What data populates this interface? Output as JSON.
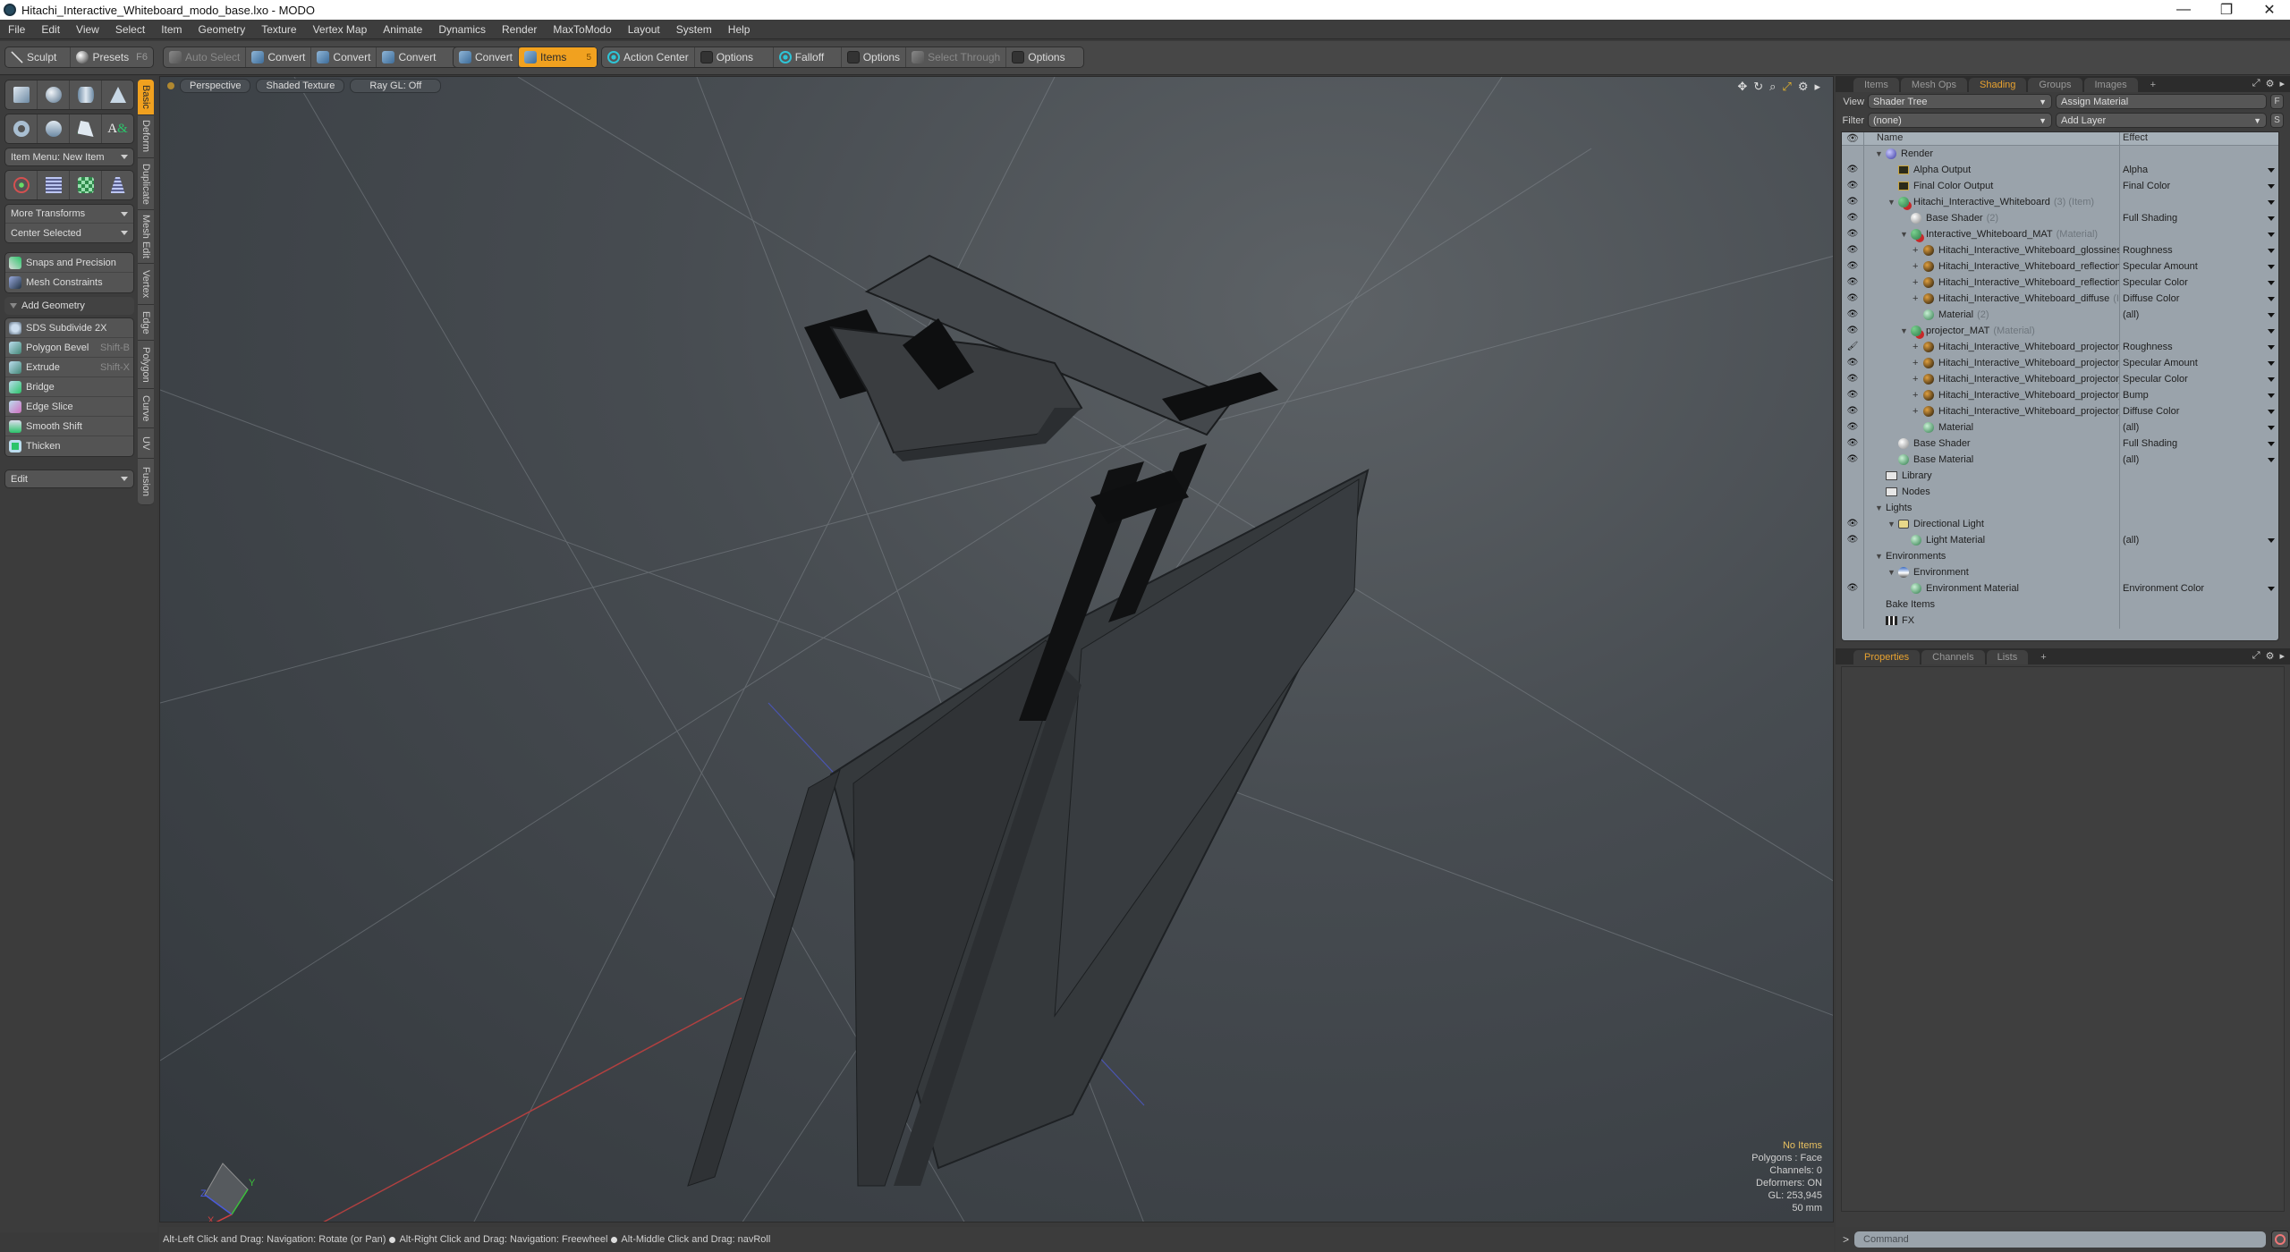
{
  "window": {
    "title": "Hitachi_Interactive_Whiteboard_modo_base.lxo - MODO",
    "controls": [
      "minimize",
      "restore",
      "close"
    ]
  },
  "menu": [
    "File",
    "Edit",
    "View",
    "Select",
    "Item",
    "Geometry",
    "Texture",
    "Vertex Map",
    "Animate",
    "Dynamics",
    "Render",
    "MaxToModo",
    "Layout",
    "System",
    "Help"
  ],
  "toolbar": {
    "sculpt": "Sculpt",
    "presets": "Presets",
    "presets_shortcut": "F6",
    "auto_select": "Auto Select",
    "convert1": "Convert",
    "convert2": "Convert",
    "convert3": "Convert",
    "convert4": "Convert",
    "items": "Items",
    "items_badge": "5",
    "action_center": "Action Center",
    "options1": "Options",
    "falloff": "Falloff",
    "options2": "Options",
    "select_through": "Select Through",
    "options3": "Options"
  },
  "left_panel": {
    "item_menu": "Item Menu: New Item",
    "more_transforms": "More Transforms",
    "center_selected": "Center Selected",
    "snaps": "Snaps and Precision",
    "mesh_constraints": "Mesh Constraints",
    "add_geometry": "Add Geometry",
    "tools": [
      {
        "label": "SDS Subdivide 2X",
        "shortcut": ""
      },
      {
        "label": "Polygon Bevel",
        "shortcut": "Shift-B"
      },
      {
        "label": "Extrude",
        "shortcut": "Shift-X"
      },
      {
        "label": "Bridge",
        "shortcut": ""
      },
      {
        "label": "Edge Slice",
        "shortcut": ""
      },
      {
        "label": "Smooth Shift",
        "shortcut": ""
      },
      {
        "label": "Thicken",
        "shortcut": ""
      }
    ],
    "edit_dropdown": "Edit",
    "vtabs": [
      "Basic",
      "Deform",
      "Duplicate",
      "Mesh Edit",
      "Vertex",
      "Edge",
      "Polygon",
      "Curve",
      "UV",
      "Fusion"
    ]
  },
  "viewport": {
    "view": "Perspective",
    "shading": "Shaded Texture",
    "raygl": "Ray GL: Off",
    "info": [
      "No Items",
      "Polygons : Face",
      "Channels: 0",
      "Deformers: ON",
      "GL: 253,945",
      "50 mm"
    ],
    "axes": {
      "x": "X",
      "y": "Y",
      "z": "Z"
    }
  },
  "right_panel": {
    "tabs": [
      "Items",
      "Mesh Ops",
      "Shading",
      "Groups",
      "Images"
    ],
    "active_tab": "Shading",
    "view_label": "View",
    "view_value": "Shader Tree",
    "assign_material": "Assign Material",
    "f_btn": "F",
    "filter_label": "Filter",
    "filter_value": "(none)",
    "add_layer": "Add Layer",
    "s_btn": "S",
    "col_name": "Name",
    "col_effect": "Effect",
    "rows": [
      {
        "eye": "",
        "indent": 0,
        "exp": "▼",
        "icon": "b-blue",
        "name": "Render",
        "muted": "",
        "effect": "",
        "arrow": false
      },
      {
        "eye": "👁",
        "indent": 1,
        "exp": "",
        "icon": "b-img",
        "name": "Alpha Output",
        "muted": "",
        "effect": "Alpha",
        "arrow": true
      },
      {
        "eye": "👁",
        "indent": 1,
        "exp": "",
        "icon": "b-img",
        "name": "Final Color Output",
        "muted": "",
        "effect": "Final Color",
        "arrow": true
      },
      {
        "eye": "👁",
        "indent": 1,
        "exp": "▼",
        "icon": "b-mat",
        "name": "Hitachi_Interactive_Whiteboard",
        "muted": "(3) (Item)",
        "effect": "",
        "arrow": true
      },
      {
        "eye": "👁",
        "indent": 2,
        "exp": "",
        "icon": "b-white",
        "name": "Base Shader",
        "muted": "(2)",
        "effect": "Full Shading",
        "arrow": true
      },
      {
        "eye": "👁",
        "indent": 2,
        "exp": "▼",
        "icon": "b-mat",
        "name": "Interactive_Whiteboard_MAT",
        "muted": "(Material)",
        "effect": "",
        "arrow": true
      },
      {
        "eye": "👁",
        "indent": 3,
        "exp": "+",
        "icon": "b-gold",
        "name": "Hitachi_Interactive_Whiteboard_glossiness",
        "muted": "…",
        "effect": "Roughness",
        "arrow": true
      },
      {
        "eye": "👁",
        "indent": 3,
        "exp": "+",
        "icon": "b-gold",
        "name": "Hitachi_Interactive_Whiteboard_reflection",
        "muted": "(…",
        "effect": "Specular Amount",
        "arrow": true
      },
      {
        "eye": "👁",
        "indent": 3,
        "exp": "+",
        "icon": "b-gold",
        "name": "Hitachi_Interactive_Whiteboard_reflection",
        "muted": "(…",
        "effect": "Specular Color",
        "arrow": true
      },
      {
        "eye": "👁",
        "indent": 3,
        "exp": "+",
        "icon": "b-gold",
        "name": "Hitachi_Interactive_Whiteboard_diffuse",
        "muted": "(Im…",
        "effect": "Diffuse Color",
        "arrow": true
      },
      {
        "eye": "👁",
        "indent": 3,
        "exp": "",
        "icon": "b-green",
        "name": "Material",
        "muted": "(2)",
        "effect": "(all)",
        "arrow": true
      },
      {
        "eye": "👁",
        "indent": 2,
        "exp": "▼",
        "icon": "b-mat",
        "name": "projector_MAT",
        "muted": "(Material)",
        "effect": "",
        "arrow": true
      },
      {
        "eye": "🖌",
        "indent": 3,
        "exp": "+",
        "icon": "b-gold",
        "name": "Hitachi_Interactive_Whiteboard_projector_ …",
        "muted": "",
        "effect": "Roughness",
        "arrow": true
      },
      {
        "eye": "👁",
        "indent": 3,
        "exp": "+",
        "icon": "b-gold",
        "name": "Hitachi_Interactive_Whiteboard_projector_ …",
        "muted": "",
        "effect": "Specular Amount",
        "arrow": true
      },
      {
        "eye": "👁",
        "indent": 3,
        "exp": "+",
        "icon": "b-gold",
        "name": "Hitachi_Interactive_Whiteboard_projector_ …",
        "muted": "",
        "effect": "Specular Color",
        "arrow": true
      },
      {
        "eye": "👁",
        "indent": 3,
        "exp": "+",
        "icon": "b-gold",
        "name": "Hitachi_Interactive_Whiteboard_projector_ …",
        "muted": "",
        "effect": "Bump",
        "arrow": true
      },
      {
        "eye": "👁",
        "indent": 3,
        "exp": "+",
        "icon": "b-gold",
        "name": "Hitachi_Interactive_Whiteboard_projector_ …",
        "muted": "",
        "effect": "Diffuse Color",
        "arrow": true
      },
      {
        "eye": "👁",
        "indent": 3,
        "exp": "",
        "icon": "b-green",
        "name": "Material",
        "muted": "",
        "effect": "(all)",
        "arrow": true
      },
      {
        "eye": "👁",
        "indent": 1,
        "exp": "",
        "icon": "b-white",
        "name": "Base Shader",
        "muted": "",
        "effect": "Full Shading",
        "arrow": true
      },
      {
        "eye": "👁",
        "indent": 1,
        "exp": "",
        "icon": "b-green",
        "name": "Base Material",
        "muted": "",
        "effect": "(all)",
        "arrow": true
      },
      {
        "eye": "",
        "indent": 0,
        "exp": "",
        "icon": "b-folder",
        "name": "Library",
        "muted": "",
        "effect": "",
        "arrow": false
      },
      {
        "eye": "",
        "indent": 0,
        "exp": "",
        "icon": "b-folder",
        "name": "Nodes",
        "muted": "",
        "effect": "",
        "arrow": false
      },
      {
        "eye": "",
        "indent": 0,
        "exp": "▼",
        "icon": "",
        "name": "Lights",
        "muted": "",
        "effect": "",
        "arrow": false
      },
      {
        "eye": "👁",
        "indent": 1,
        "exp": "▼",
        "icon": "b-light",
        "name": "Directional Light",
        "muted": "",
        "effect": "",
        "arrow": false
      },
      {
        "eye": "👁",
        "indent": 2,
        "exp": "",
        "icon": "b-green",
        "name": "Light Material",
        "muted": "",
        "effect": "(all)",
        "arrow": true
      },
      {
        "eye": "",
        "indent": 0,
        "exp": "▼",
        "icon": "",
        "name": "Environments",
        "muted": "",
        "effect": "",
        "arrow": false
      },
      {
        "eye": "",
        "indent": 1,
        "exp": "▼",
        "icon": "b-env",
        "name": "Environment",
        "muted": "",
        "effect": "",
        "arrow": false
      },
      {
        "eye": "👁",
        "indent": 2,
        "exp": "",
        "icon": "b-green",
        "name": "Environment Material",
        "muted": "",
        "effect": "Environment Color",
        "arrow": true
      },
      {
        "eye": "",
        "indent": 0,
        "exp": "",
        "icon": "",
        "name": "Bake Items",
        "muted": "",
        "effect": "",
        "arrow": false
      },
      {
        "eye": "",
        "indent": 0,
        "exp": "",
        "icon": "b-fx",
        "name": "FX",
        "muted": "",
        "effect": "",
        "arrow": false
      }
    ],
    "bottom_tabs": [
      "Properties",
      "Channels",
      "Lists"
    ],
    "bottom_active": "Properties"
  },
  "command": {
    "prompt": ">",
    "placeholder": "Command"
  },
  "status": [
    "Alt-Left Click and Drag: Navigation: Rotate (or Pan)",
    "Alt-Right Click and Drag: Navigation: Freewheel",
    "Alt-Middle Click and Drag: navRoll"
  ],
  "colors": {
    "accent": "#f1a11f",
    "tree_bg": "#9aa3ab",
    "viewport_bg": "#474c51"
  }
}
